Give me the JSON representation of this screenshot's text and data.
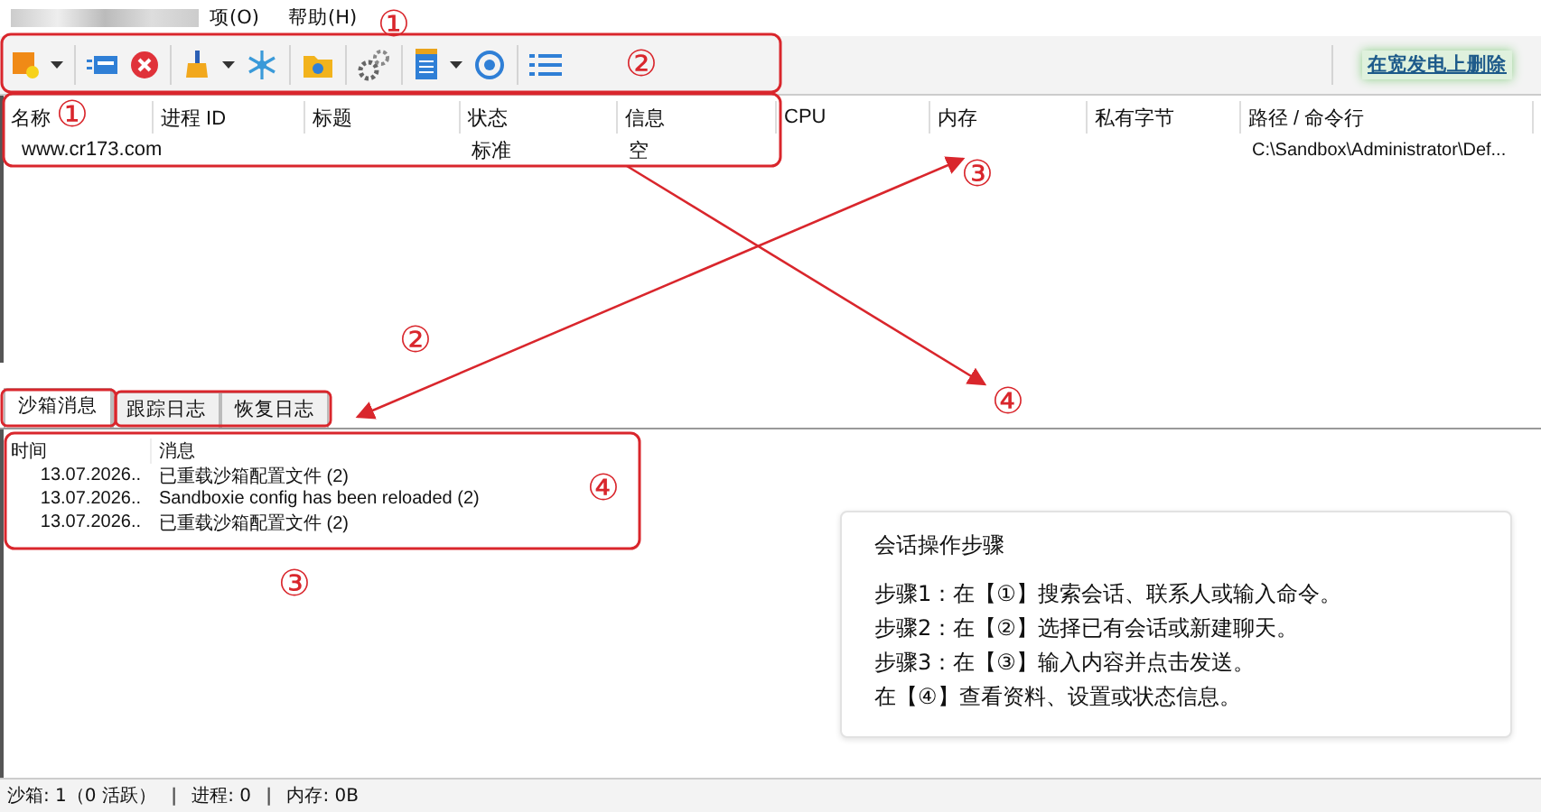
{
  "menu": [
    {
      "label": "项(O)"
    },
    {
      "label": "帮助(H)"
    }
  ],
  "toolbar": {
    "link": "在宽发电上删除"
  },
  "process_table": {
    "columns": [
      "名称",
      "进程 ID",
      "标题",
      "状态",
      "信息",
      "CPU",
      "内存",
      "私有字节",
      "路径 / 命令行"
    ],
    "rows": [
      {
        "cells": [
          "www.cr173.com",
          "",
          "",
          "标准",
          "空",
          "",
          "",
          "",
          "C:\\Sandbox\\Administrator\\Def..."
        ]
      }
    ]
  },
  "tabs": [
    {
      "label": "沙箱消息",
      "selected": true
    },
    {
      "label": "跟踪日志",
      "selected": false
    },
    {
      "label": "恢复日志",
      "selected": false
    }
  ],
  "log_table": {
    "columns": [
      "时间",
      "消息"
    ],
    "rows": [
      [
        "13.07.2026..",
        "已重载沙箱配置文件 (2)"
      ],
      [
        "13.07.2026..",
        "Sandboxie config has been reloaded (2)"
      ],
      [
        "13.07.2026..",
        "已重载沙箱配置文件 (2)"
      ]
    ]
  },
  "callouts": [
    "①",
    "②",
    "①",
    "③",
    "②",
    "④",
    "④",
    "③"
  ],
  "steps_card": {
    "title": "会话操作步骤",
    "lines": [
      "步骤1：在【①】搜索会话、联系人或输入命令。",
      "步骤2：在【②】选择已有会话或新建聊天。",
      "步骤3：在【③】输入内容并点击发送。",
      "在【④】查看资料、设置或状态信息。"
    ]
  },
  "status_bar": [
    {
      "kind": "text",
      "text": "沙箱: 1（0 活跃）"
    },
    {
      "kind": "separator",
      "text": "|"
    },
    {
      "kind": "text",
      "text": "进程: 0"
    },
    {
      "kind": "separator",
      "text": "|"
    },
    {
      "kind": "text",
      "text": "内存: 0B"
    }
  ]
}
